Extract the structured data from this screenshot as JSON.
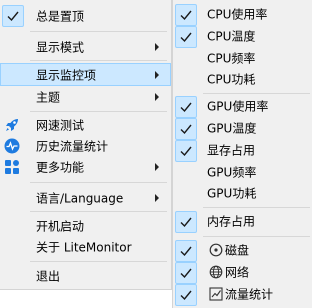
{
  "main_menu": {
    "always_on_top": {
      "label": "总是置顶",
      "checked": true
    },
    "display_mode": {
      "label": "显示模式"
    },
    "display_monitor_items": {
      "label": "显示监控项"
    },
    "theme": {
      "label": "主题"
    },
    "speed_test": {
      "label": "网速测试",
      "icon": "rocket-icon"
    },
    "traffic_history": {
      "label": "历史流量统计",
      "icon": "pulse-icon"
    },
    "more_features": {
      "label": "更多功能",
      "icon": "grid-icon"
    },
    "language": {
      "label": "语言/Language"
    },
    "auto_start": {
      "label": "开机启动"
    },
    "about": {
      "label": "关于 LiteMonitor"
    },
    "exit": {
      "label": "退出"
    }
  },
  "sub_menu": {
    "items": [
      {
        "label": "CPU使用率",
        "checked": true
      },
      {
        "label": "CPU温度",
        "checked": true
      },
      {
        "label": "CPU频率",
        "checked": false
      },
      {
        "label": "CPU功耗",
        "checked": false
      },
      {
        "label": "GPU使用率",
        "checked": true
      },
      {
        "label": "GPU温度",
        "checked": true
      },
      {
        "label": "显存占用",
        "checked": true
      },
      {
        "label": "GPU频率",
        "checked": false
      },
      {
        "label": "GPU功耗",
        "checked": false
      },
      {
        "label": "内存占用",
        "checked": true
      },
      {
        "label": "磁盘",
        "checked": true,
        "icon": "disk-icon"
      },
      {
        "label": "网络",
        "checked": true,
        "icon": "globe-icon"
      },
      {
        "label": "流量统计",
        "checked": true,
        "icon": "chart-box-icon"
      }
    ]
  },
  "colors": {
    "menu_bg": "#f0f0f0",
    "highlight": "#cce8ff",
    "highlight_border": "#99d1ff",
    "check_color": "#1a1a1a",
    "icon_blue": "#1e7be0"
  }
}
